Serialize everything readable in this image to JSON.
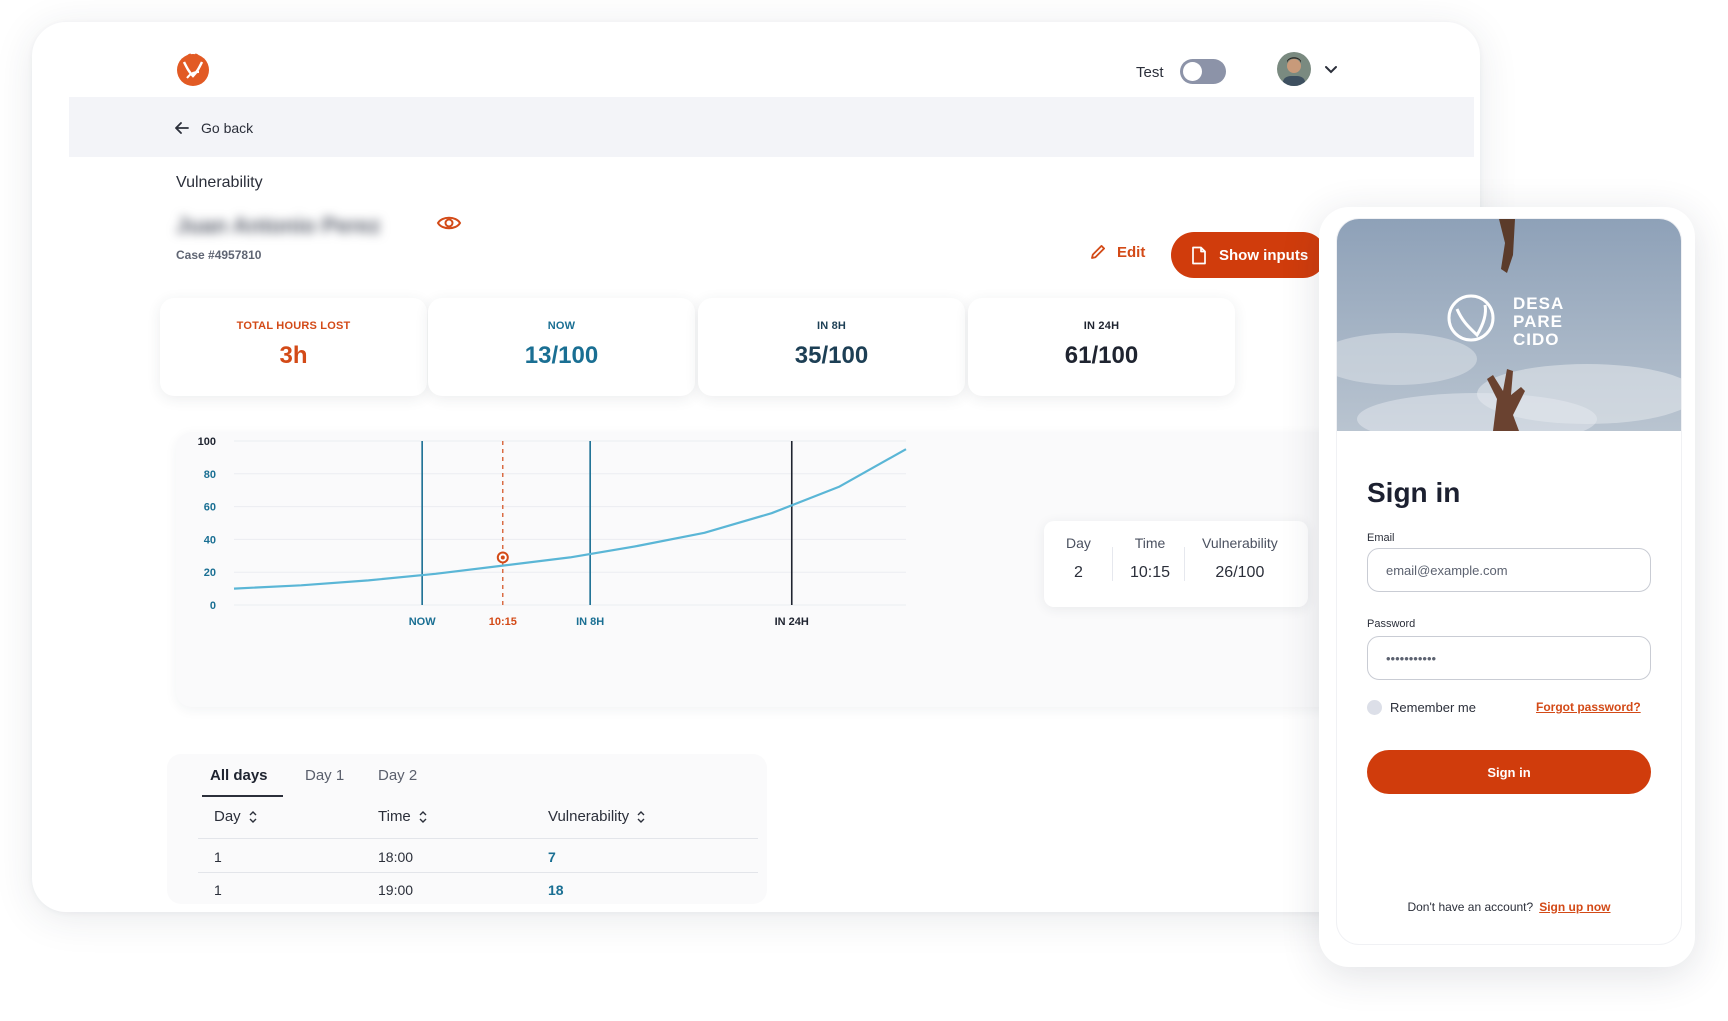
{
  "header": {
    "test_label": "Test"
  },
  "nav": {
    "go_back": "Go back"
  },
  "case": {
    "section": "Vulnerability",
    "person_name": "Juan Antonio Perez",
    "case_number": "Case #4957810",
    "edit_label": "Edit",
    "show_inputs_label": "Show inputs"
  },
  "stats": [
    {
      "label": "TOTAL HOURS LOST",
      "value": "3h",
      "color": "#d34a17"
    },
    {
      "label": "NOW",
      "value": "13/100",
      "color": "#1a6f93"
    },
    {
      "label": "IN 8H",
      "value": "35/100",
      "color": "#1d3f55"
    },
    {
      "label": "IN 24H",
      "value": "61/100",
      "color": "#1f2430"
    }
  ],
  "chart_data": {
    "type": "line",
    "y_ticks": [
      "100",
      "80",
      "60",
      "40",
      "20",
      "0"
    ],
    "ylim": [
      0,
      100
    ],
    "series": [
      {
        "x": [
          0,
          0.1,
          0.2,
          0.3,
          0.4,
          0.5,
          0.6,
          0.7,
          0.8,
          0.9,
          1.0
        ],
        "values": [
          10,
          12,
          15,
          19,
          24,
          29,
          36,
          44,
          56,
          72,
          95
        ]
      }
    ],
    "markers": [
      {
        "label": "NOW",
        "x": 0.28,
        "style": "solid",
        "color": "#1a6f93"
      },
      {
        "label": "10:15",
        "x": 0.4,
        "style": "dashed",
        "color": "#d34a17"
      },
      {
        "label": "IN 8H",
        "x": 0.53,
        "style": "solid",
        "color": "#1a6f93"
      },
      {
        "label": "IN 24H",
        "x": 0.83,
        "style": "solid",
        "color": "#1f2430"
      }
    ],
    "highlight_point": {
      "x": 0.4,
      "y": 29
    },
    "line_color": "#5ab6d6",
    "grid": true
  },
  "tooltip": {
    "day_label": "Day",
    "day_value": "2",
    "time_label": "Time",
    "time_value": "10:15",
    "vuln_label": "Vulnerability",
    "vuln_value": "26/100"
  },
  "table": {
    "tabs": [
      "All days",
      "Day 1",
      "Day 2"
    ],
    "headers": [
      "Day",
      "Time",
      "Vulnerability"
    ],
    "rows": [
      {
        "day": "1",
        "time": "18:00",
        "vulnerability": "7"
      },
      {
        "day": "1",
        "time": "19:00",
        "vulnerability": "18"
      }
    ]
  },
  "signin": {
    "brand": [
      "DESA",
      "PARE",
      "CIDO"
    ],
    "title": "Sign in",
    "email_label": "Email",
    "email_placeholder": "email@example.com",
    "password_label": "Password",
    "password_value": "•••••••••••",
    "remember_label": "Remember me",
    "forgot_label": "Forgot password?",
    "button_label": "Sign in",
    "no_account": "Don't have an account?",
    "signup_label": "Sign up now"
  },
  "colors": {
    "accent": "#d03c0c",
    "teal": "#1a6f93"
  }
}
